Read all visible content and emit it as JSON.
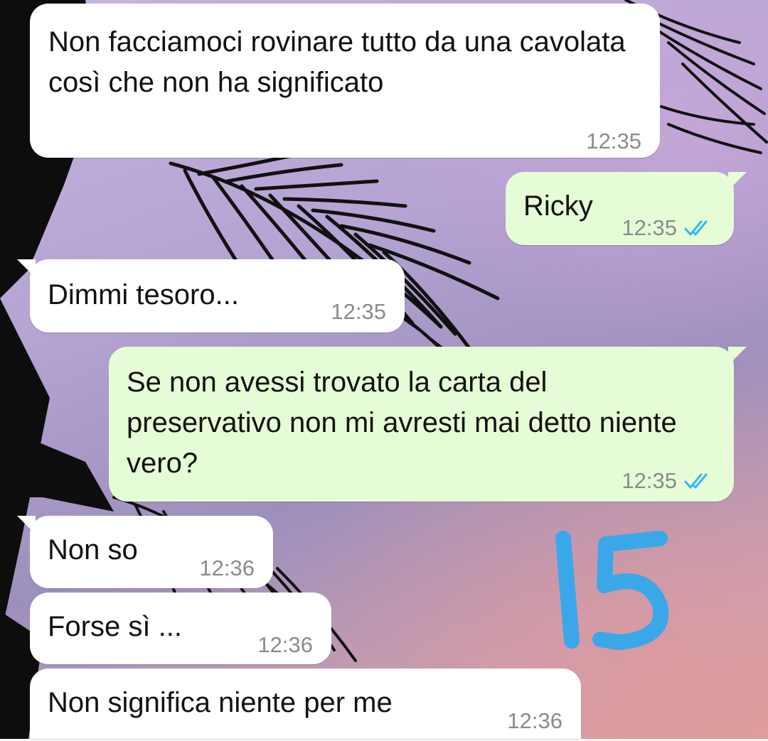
{
  "colors": {
    "incoming_bubble": "#ffffff",
    "outgoing_bubble": "#e6fcd6",
    "timestamp": "#8b8b8b",
    "read_ticks": "#34b7f1",
    "sticker": "#3aa8e8"
  },
  "messages": [
    {
      "direction": "in",
      "text": "Non facciamoci rovinare tutto da una cavolata così che non ha significato",
      "time": "12:35"
    },
    {
      "direction": "out",
      "text": "Ricky",
      "time": "12:35",
      "status_icon": "double-check-icon"
    },
    {
      "direction": "in",
      "text": "Dimmi tesoro...",
      "time": "12:35"
    },
    {
      "direction": "out",
      "text": "Se non avessi trovato la carta del preservativo non mi avresti mai detto niente vero?",
      "time": "12:35",
      "status_icon": "double-check-icon"
    },
    {
      "direction": "in",
      "text": "Non so",
      "time": "12:36"
    },
    {
      "direction": "in",
      "text": "Forse sì ...",
      "time": "12:36"
    },
    {
      "direction": "in",
      "text": "Non significa niente per me",
      "time": "12:36"
    }
  ],
  "overlay": {
    "handwritten_label": "15"
  }
}
